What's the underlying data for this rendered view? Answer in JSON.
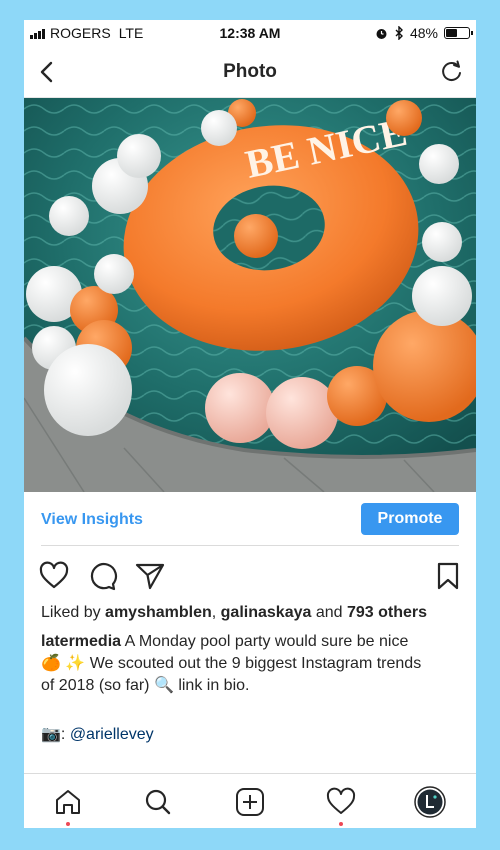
{
  "status_bar": {
    "carrier": "ROGERS",
    "network": "LTE",
    "time": "12:38 AM",
    "battery": "48%",
    "battery_level": 0.48
  },
  "nav": {
    "title": "Photo",
    "back_icon": "chevron-left-icon",
    "refresh_icon": "refresh-icon"
  },
  "photo": {
    "float_text": "BE NICE",
    "colors": {
      "pool": "#1f6e6a",
      "float": "#f47a2b",
      "deck": "#8b8e8c"
    }
  },
  "insights": {
    "view_insights_label": "View Insights",
    "promote_label": "Promote",
    "accent": "#3897f0"
  },
  "actions": {
    "like_icon": "heart-icon",
    "comment_icon": "comment-icon",
    "share_icon": "share-icon",
    "save_icon": "bookmark-icon"
  },
  "post": {
    "likes_prefix": "Liked by ",
    "liker_1": "amyshamblen",
    "separator": ", ",
    "liker_2": "galinaskaya",
    "and_text": " and ",
    "others": "793 others",
    "caption_user": "latermedia",
    "caption_line1": " A Monday pool party would sure be nice",
    "caption_line2": "🍊 ✨ We scouted out the 9 biggest Instagram trends",
    "caption_line3": "of 2018 (so far) 🔍 link in bio.",
    "credit_prefix": "📷: ",
    "credit_mention": "@ariellevey"
  },
  "tab_bar": {
    "items": [
      "home-icon",
      "search-icon",
      "add-icon",
      "activity-icon",
      "profile-icon"
    ]
  }
}
